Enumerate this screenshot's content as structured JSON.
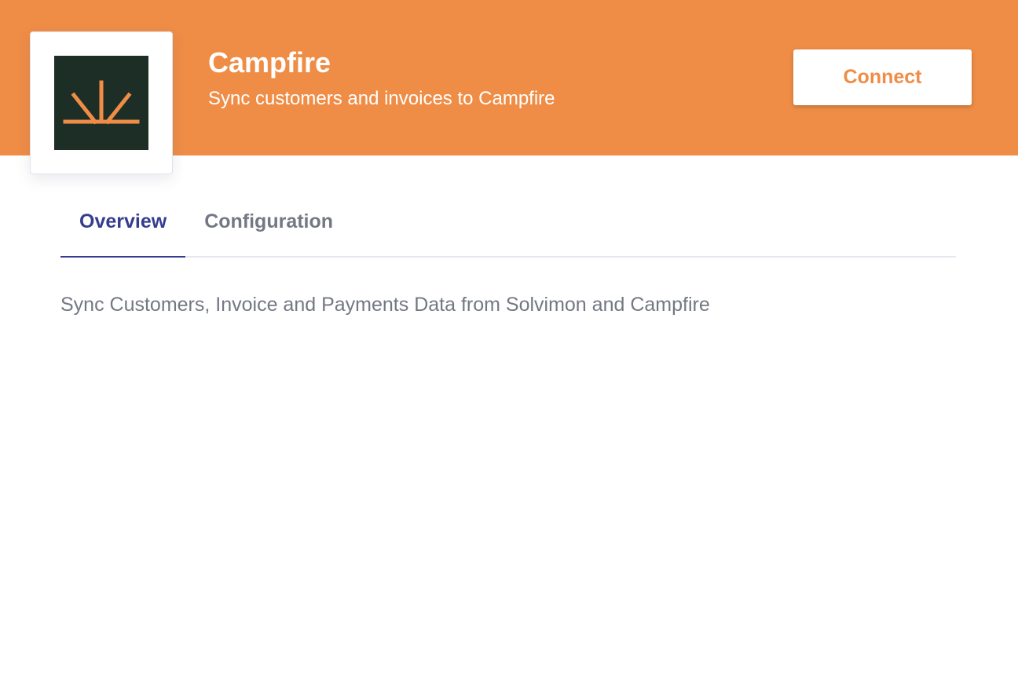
{
  "header": {
    "app_name": "Campfire",
    "app_description": "Sync customers and invoices to Campfire",
    "connect_label": "Connect",
    "logo_icon": "campfire-logo-icon"
  },
  "tabs": [
    {
      "label": "Overview",
      "active": true
    },
    {
      "label": "Configuration",
      "active": false
    }
  ],
  "overview": {
    "text": "Sync Customers, Invoice and Payments Data from Solvimon and Campfire"
  },
  "colors": {
    "banner": "#ef8d47",
    "logo_tile": "#1d2e26",
    "active_tab": "#343d8e",
    "muted_text": "#737883"
  }
}
